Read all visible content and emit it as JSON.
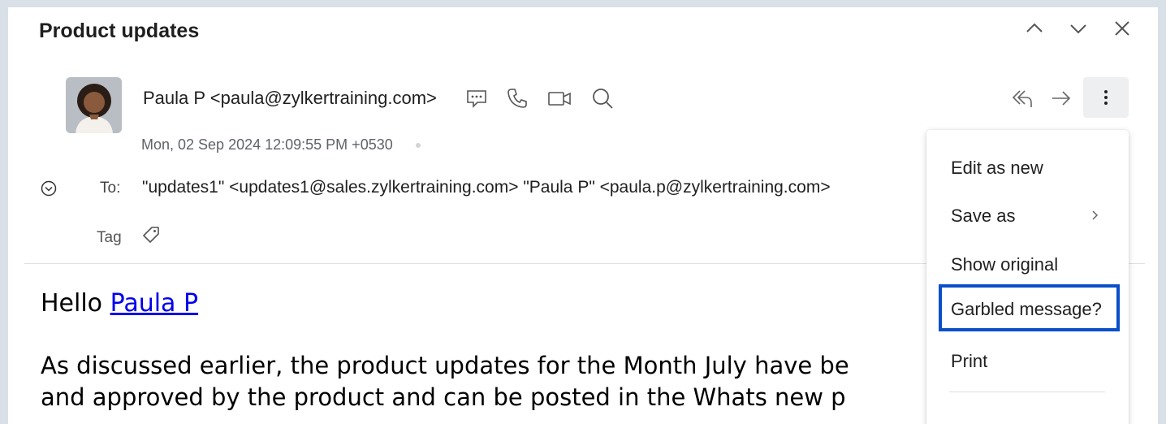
{
  "email": {
    "subject": "Product updates",
    "sender": "Paula P <paula@zylkertraining.com>",
    "date": "Mon, 02 Sep 2024 12:09:55 PM +0530",
    "to_label": "To:",
    "to_value": "\"updates1\" <updates1@sales.zylkertraining.com> \"Paula P\" <paula.p@zylkertraining.com>",
    "tag_label": "Tag",
    "body": {
      "greeting_prefix": "Hello ",
      "greeting_link": "Paula P",
      "line1": "As discussed earlier, the product updates for the Month July have be",
      "line2": "and approved by the product and can be posted in the Whats new p"
    }
  },
  "menu": {
    "items": [
      {
        "label": "Edit as new"
      },
      {
        "label": "Save as"
      },
      {
        "label": "Show original"
      },
      {
        "label": "Garbled message?"
      },
      {
        "label": "Print"
      }
    ]
  },
  "icons": {
    "nav": [
      "chevron-up-icon",
      "chevron-down-icon",
      "close-icon"
    ],
    "sender": [
      "chat-icon",
      "phone-icon",
      "video-icon",
      "search-icon"
    ],
    "actions": [
      "reply-all-icon",
      "forward-icon",
      "more-vertical-icon"
    ]
  },
  "colors": {
    "link": "#0000ee",
    "highlight_border": "#0a4fc9",
    "background": "#d9e0e7"
  }
}
